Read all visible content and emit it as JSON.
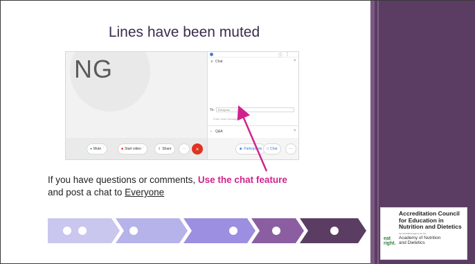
{
  "slide": {
    "title": "Lines have been muted",
    "body_text": "If you have questions or comments,",
    "highlight_text": "Use the chat feature",
    "body_text_2": "and post a chat to",
    "underlined_text": "Everyone"
  },
  "zoom": {
    "initials": "NG",
    "panel": {
      "chat_header": "Chat",
      "to_label": "To:",
      "to_value": "Everyone",
      "input_placeholder": "Enter chat message",
      "qa_header": "Q&A"
    },
    "toolbar": {
      "mute_label": "Mute",
      "start_video_label": "Start video",
      "share_label": "Share",
      "more_label": "···",
      "participants_label": "Participants",
      "chat_label": "Chat"
    }
  },
  "logo": {
    "line1": "Accreditation Council",
    "line2": "for Education in",
    "line3": "Nutrition and Dietetics",
    "fine_print": "the accrediting agency for the",
    "brand_top": "eat",
    "brand_bottom": "right.",
    "academy_line1": "Academy of Nutrition",
    "academy_line2": "and Dietetics"
  },
  "colors": {
    "sidebar": "#5b3d64",
    "accent_magenta": "#d0228d",
    "chevron_1": "#c9c7ee",
    "chevron_2": "#b6b3ea",
    "chevron_3": "#9c8ee0",
    "chevron_4": "#8a5ea0",
    "chevron_5": "#5b3d64"
  }
}
